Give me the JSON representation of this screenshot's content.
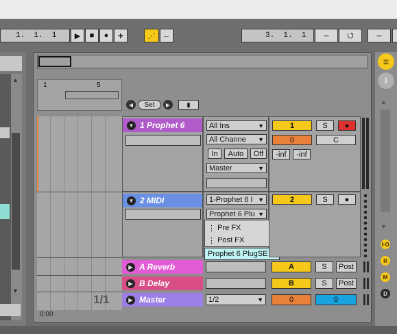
{
  "transport": {
    "position": "1.  1.  1",
    "loop_end": "3.  1.  1"
  },
  "arrangement": {
    "bar_markers": [
      "1",
      "5"
    ],
    "set_label": "Set",
    "counter": "1/1",
    "time_marker": "0:00"
  },
  "tracks": [
    {
      "name": "1 Prophet 6",
      "color": "#b05bc9",
      "input_type": "All Ins",
      "input_channel": "All Channe",
      "monitor": [
        "In",
        "Auto",
        "Off"
      ],
      "output": "Master",
      "number": "1",
      "solo": "S",
      "volume": "0",
      "pan": "C",
      "meter_left": "-inf",
      "meter_right": "-inf"
    },
    {
      "name": "2 MIDI",
      "color": "#6a90e3",
      "input_type": "1-Prophet 6 I",
      "input_channel": "Prophet 6 Plu",
      "number": "2",
      "solo": "S"
    }
  ],
  "dropdown_menu": {
    "items": [
      "Pre FX",
      "Post FX"
    ],
    "highlighted": "Prophet 6 PlugSE"
  },
  "returns": [
    {
      "name": "A Reverb",
      "color": "#e25bd6",
      "letter": "A",
      "solo": "S",
      "post": "Post"
    },
    {
      "name": "B Delay",
      "color": "#d94e86",
      "letter": "B",
      "solo": "S",
      "post": "Post"
    }
  ],
  "master": {
    "name": "Master",
    "color": "#9b7fe6",
    "output": "1/2",
    "volume": "0",
    "pan": "0"
  },
  "side_buttons": [
    "I·O",
    "R",
    "M",
    "D"
  ]
}
